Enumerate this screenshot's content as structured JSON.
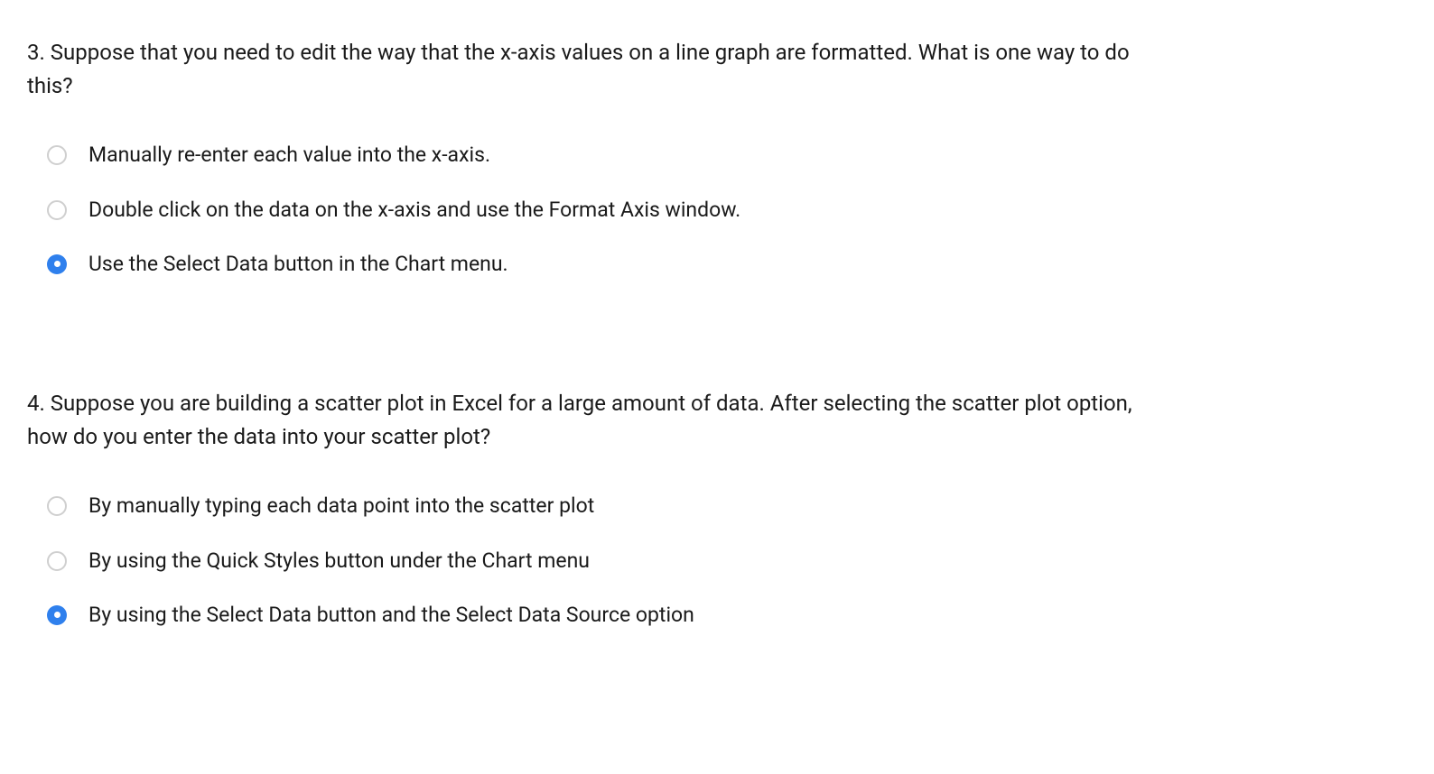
{
  "questions": [
    {
      "number": "3.",
      "text": "Suppose that you need to edit the way that the x-axis values on a line graph are formatted. What is one way to do this?",
      "options": [
        {
          "label": "Manually re-enter each value into the x-axis.",
          "selected": false
        },
        {
          "label": "Double click on the data on the x-axis and use the Format Axis window.",
          "selected": false
        },
        {
          "label": "Use the Select Data button in the Chart menu.",
          "selected": true
        }
      ]
    },
    {
      "number": "4.",
      "text": "Suppose you are building a scatter plot in Excel for a large amount of data. After selecting the scatter plot option, how do you enter the data into your scatter plot?",
      "options": [
        {
          "label": "By manually typing each data point into the scatter plot",
          "selected": false
        },
        {
          "label": "By using the Quick Styles button under the Chart menu",
          "selected": false
        },
        {
          "label": "By using the Select Data button and the Select Data Source option",
          "selected": true
        }
      ]
    }
  ]
}
